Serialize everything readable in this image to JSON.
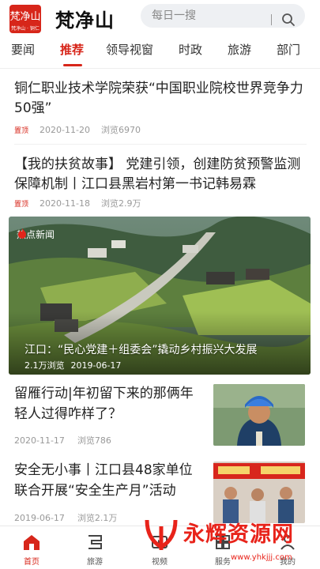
{
  "app": {
    "logo_text": "梵净山",
    "logo_sub": "梵净山 · 铜仁",
    "brand": "梵净山"
  },
  "search": {
    "placeholder": "每日一搜"
  },
  "tabs": [
    {
      "label": "要闻"
    },
    {
      "label": "推荐",
      "active": true
    },
    {
      "label": "领导视窗"
    },
    {
      "label": "时政"
    },
    {
      "label": "旅游"
    },
    {
      "label": "部门"
    }
  ],
  "articles": [
    {
      "title": "铜仁职业技术学院荣获“中国职业院校世界竞争力50强”",
      "tag": "置顶",
      "date": "2020-11-20",
      "views": "浏览6970"
    },
    {
      "title": "【我的扶贫故事】 党建引领，创建防贫预警监测保障机制丨江口县黑岩村第一书记韩易霖",
      "tag": "置顶",
      "date": "2020-11-18",
      "views": "浏览2.9万"
    }
  ],
  "hero": {
    "badge": "热点新闻",
    "title": "江口：“民心党建＋组委会”撬动乡村振兴大发展",
    "views": "2.1万浏览",
    "date": "2019-06-17"
  },
  "side_articles": [
    {
      "title": "留雁行动|年初留下来的那俩年轻人过得咋样了？",
      "date": "2020-11-17",
      "views": "浏览786"
    },
    {
      "title": "安全无小事丨江口县48家单位联合开展“安全生产月”活动",
      "date": "2019-06-17",
      "views": "浏览2.1万"
    }
  ],
  "bottom_nav": [
    {
      "label": "首页",
      "icon": "home-icon",
      "active": true
    },
    {
      "label": "旅游",
      "icon": "travel-icon"
    },
    {
      "label": "视频",
      "icon": "video-icon"
    },
    {
      "label": "服务",
      "icon": "service-icon"
    },
    {
      "label": "我的",
      "icon": "profile-icon"
    }
  ],
  "watermark": {
    "text": "永辉资源网",
    "url": "www.yhkjjj.com"
  },
  "colors": {
    "accent": "#d7261a",
    "muted": "#999999"
  }
}
